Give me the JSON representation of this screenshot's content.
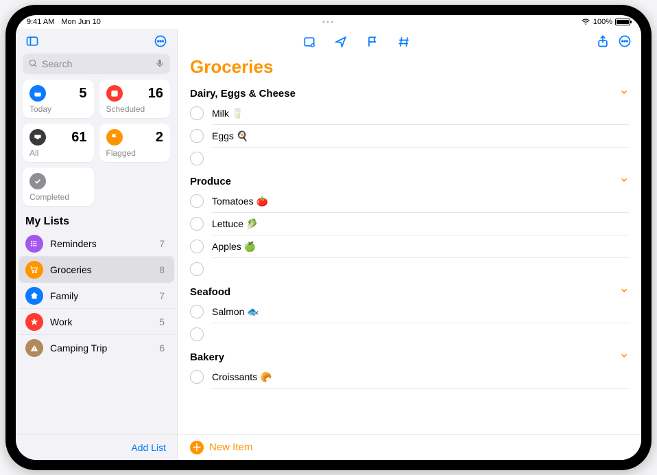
{
  "status": {
    "time": "9:41 AM",
    "date": "Mon Jun 10",
    "wifi": true,
    "battery_pct": "100%"
  },
  "sidebar": {
    "search_placeholder": "Search",
    "cards": {
      "today": {
        "label": "Today",
        "count": "5"
      },
      "scheduled": {
        "label": "Scheduled",
        "count": "16"
      },
      "all": {
        "label": "All",
        "count": "61"
      },
      "flagged": {
        "label": "Flagged",
        "count": "2"
      },
      "completed": {
        "label": "Completed"
      }
    },
    "section_title": "My Lists",
    "lists": [
      {
        "name": "Reminders",
        "count": "7",
        "color": "#a357ef",
        "icon": "list"
      },
      {
        "name": "Groceries",
        "count": "8",
        "color": "#ff9500",
        "icon": "cart",
        "selected": true
      },
      {
        "name": "Family",
        "count": "7",
        "color": "#0a7aff",
        "icon": "home"
      },
      {
        "name": "Work",
        "count": "5",
        "color": "#ff3b30",
        "icon": "star"
      },
      {
        "name": "Camping Trip",
        "count": "6",
        "color": "#b08a5a",
        "icon": "tent"
      }
    ],
    "add_list": "Add List"
  },
  "main": {
    "title": "Groceries",
    "new_item": "New Item",
    "sections": [
      {
        "name": "Dairy, Eggs & Cheese",
        "items": [
          "Milk 🥛",
          "Eggs 🍳"
        ],
        "trailing_empty": true
      },
      {
        "name": "Produce",
        "items": [
          "Tomatoes 🍅",
          "Lettuce 🥬",
          "Apples 🍏"
        ],
        "trailing_empty": true
      },
      {
        "name": "Seafood",
        "items": [
          "Salmon 🐟"
        ],
        "trailing_empty": true
      },
      {
        "name": "Bakery",
        "items": [
          "Croissants 🥐"
        ],
        "trailing_empty": false
      }
    ]
  }
}
